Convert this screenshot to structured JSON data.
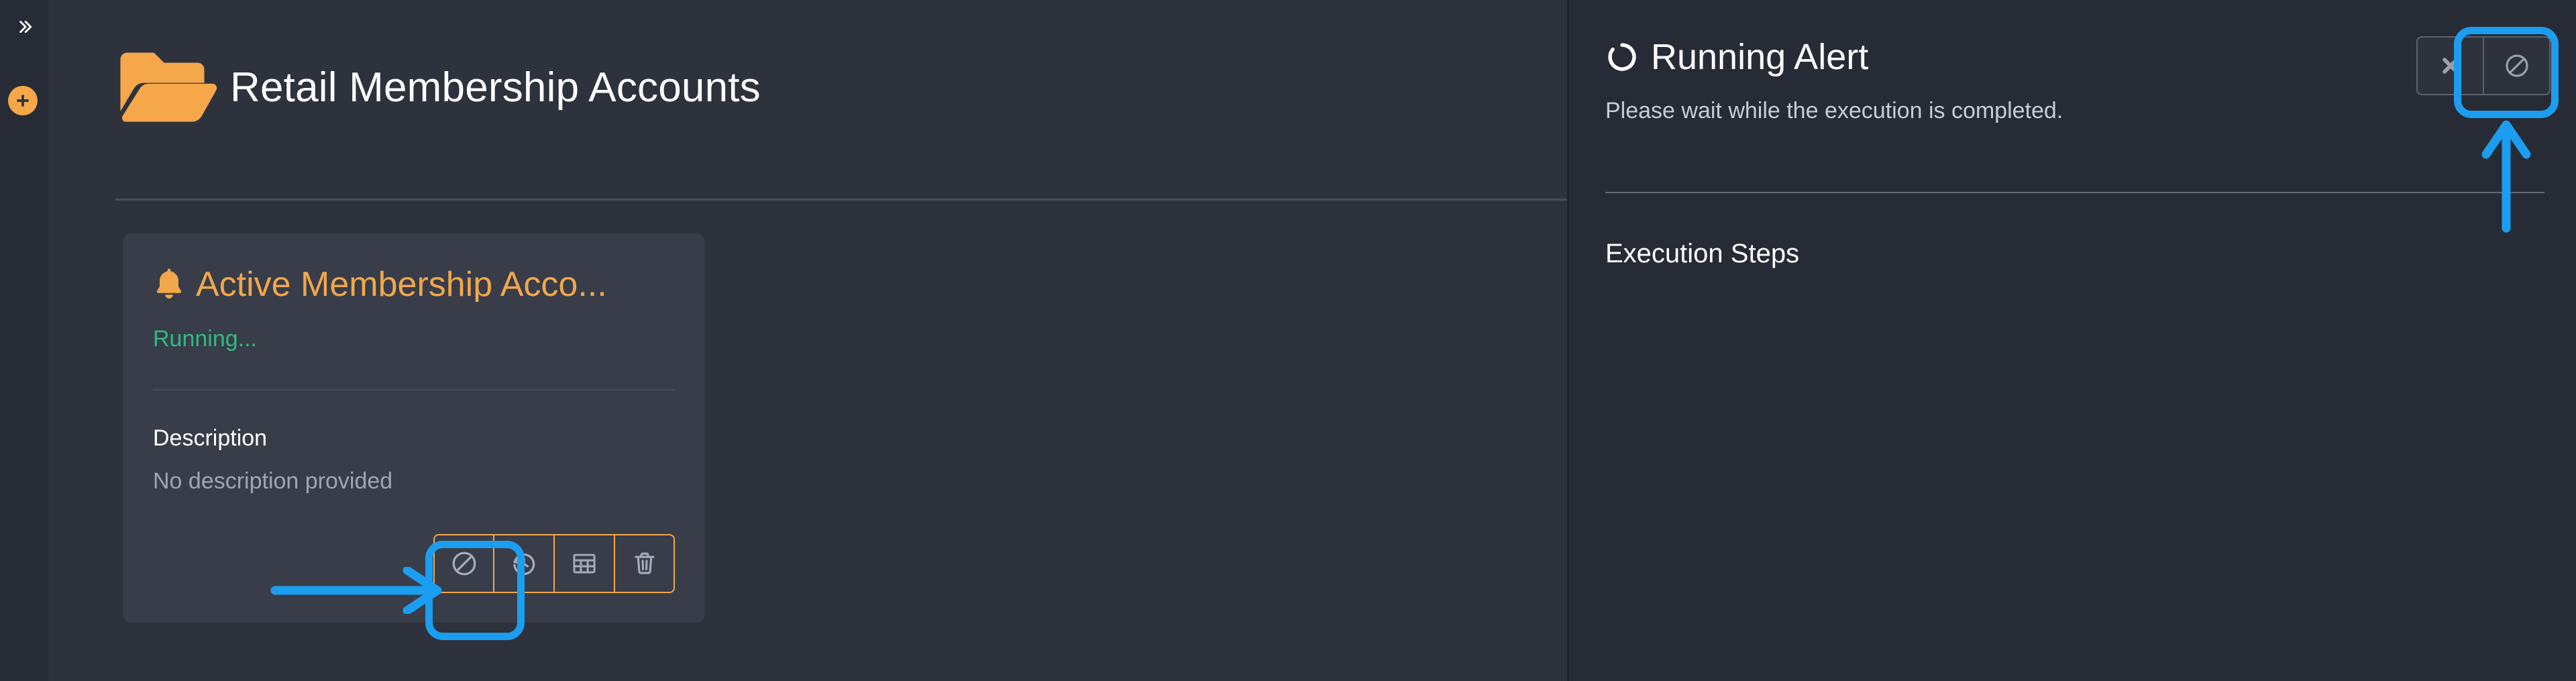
{
  "colors": {
    "accent_orange": "#f2a74b",
    "status_green": "#2fbb7f",
    "highlight_blue": "#1b9df0",
    "panel_bg": "#2e323d",
    "side_bg": "#272b35",
    "card_bg": "#383d49",
    "text_primary": "#ffffff",
    "text_muted": "#a0a5b1"
  },
  "rail": {
    "expand_icon": "chevron-double-right-icon",
    "expand_label": "»",
    "add_icon": "plus-circle-icon"
  },
  "header": {
    "icon": "open-folder-icon",
    "title": "Retail Membership Accounts"
  },
  "card": {
    "icon": "bell-icon",
    "title": "Active Membership Acco...",
    "status": "Running...",
    "description_label": "Description",
    "description_value": "No description provided",
    "actions": [
      {
        "name": "cancel-execution-button",
        "icon": "ban-icon",
        "highlighted": true
      },
      {
        "name": "history-button",
        "icon": "history-restore-icon",
        "highlighted": false
      },
      {
        "name": "results-table-button",
        "icon": "table-grid-icon",
        "highlighted": false
      },
      {
        "name": "delete-button",
        "icon": "trash-icon",
        "highlighted": false
      }
    ]
  },
  "side_panel": {
    "icon": "spinner-icon",
    "title": "Running Alert",
    "subtitle": "Please wait while the execution is completed.",
    "section_title": "Execution Steps",
    "top_buttons": [
      {
        "name": "close-button",
        "icon": "close-x-icon",
        "label": "✖",
        "highlighted": false
      },
      {
        "name": "cancel-execution-button",
        "icon": "ban-icon",
        "highlighted": true
      }
    ]
  },
  "annotations": {
    "card_arrow": "arrow-right-highlight",
    "side_arrow": "arrow-up-highlight"
  }
}
